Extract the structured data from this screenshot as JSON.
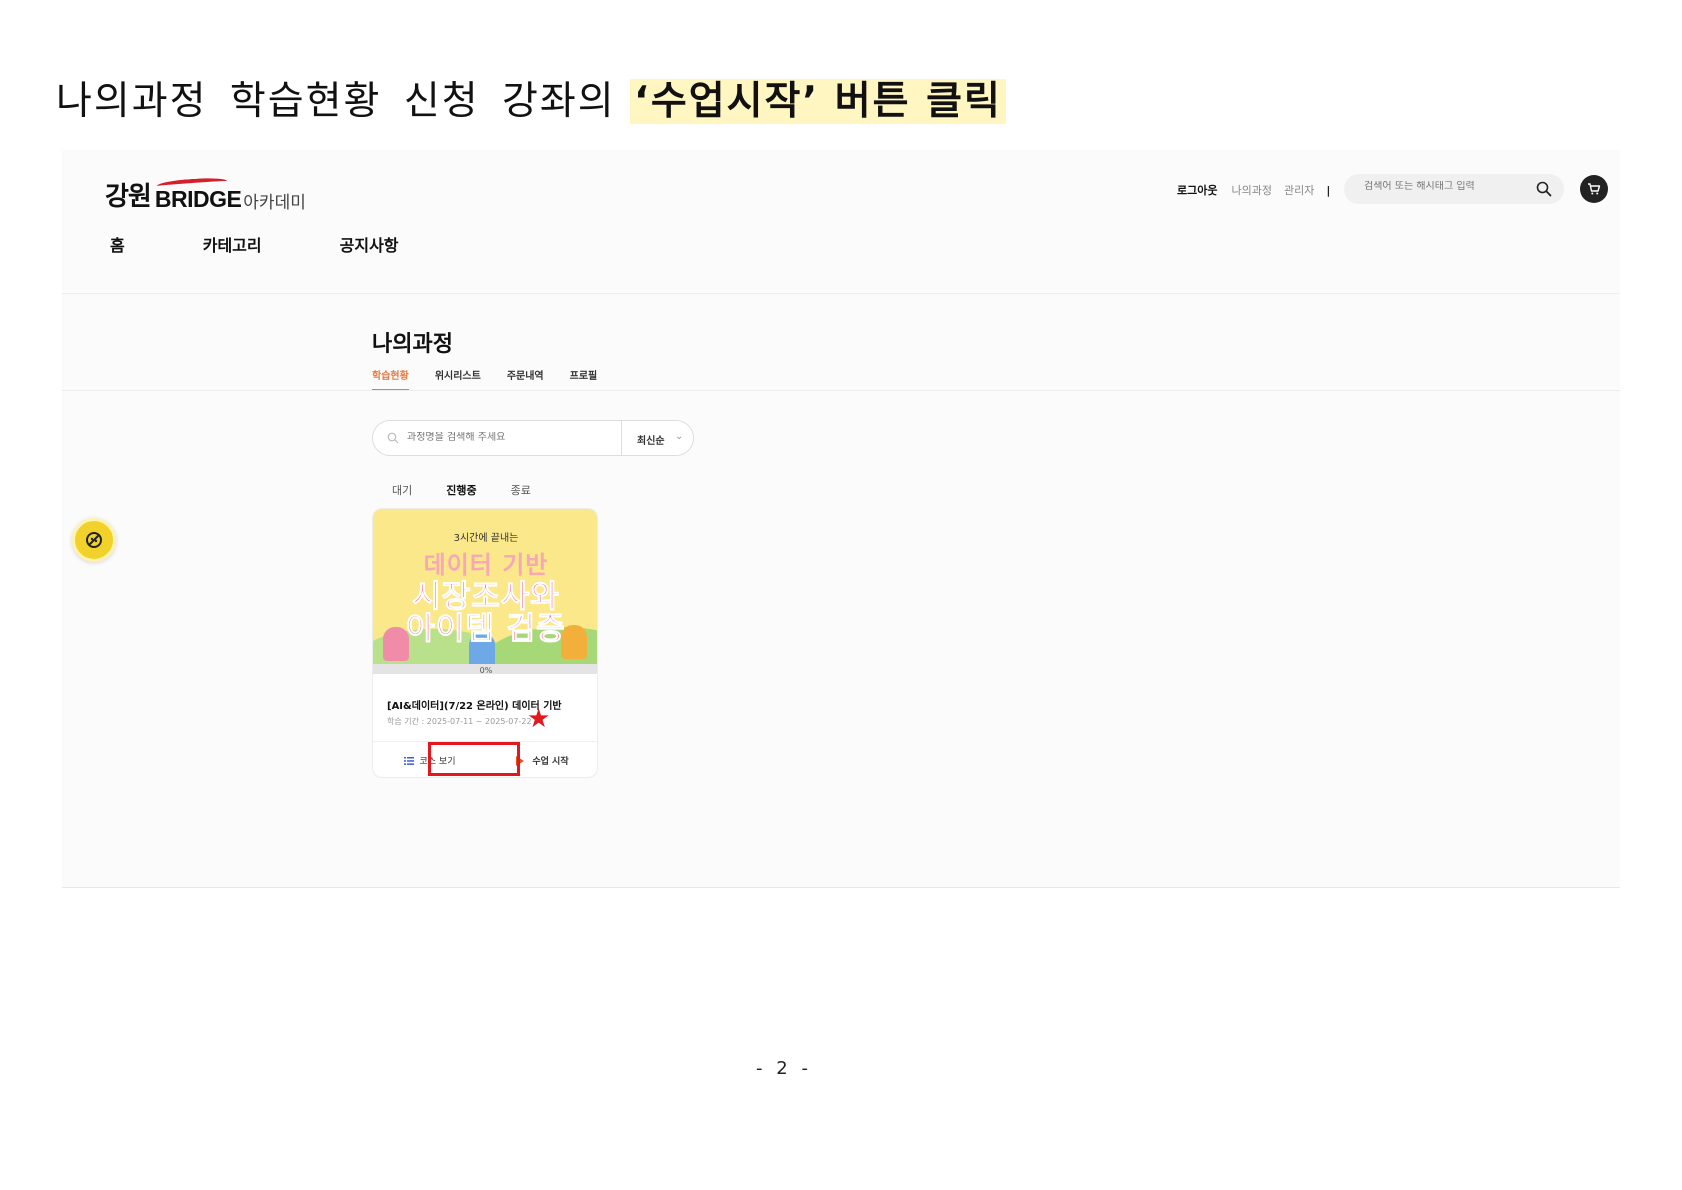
{
  "document": {
    "heading_plain": "나의과정 학습현황 신청 강좌의",
    "heading_highlight": "‘수업시작’ 버튼 클릭",
    "page_number": "- 2 -"
  },
  "site": {
    "logo": {
      "part1": "강원",
      "part2": "BRIDGE",
      "part3": "아카데미"
    },
    "top_links": {
      "logout": "로그아웃",
      "my_course": "나의과정",
      "admin": "관리자",
      "separator": "|"
    },
    "search": {
      "placeholder": "검색어 또는 해시태그 입력"
    },
    "nav": [
      "홈",
      "카테고리",
      "공지사항"
    ]
  },
  "my_course": {
    "title": "나의과정",
    "tabs": [
      "학습현황",
      "위시리스트",
      "주문내역",
      "프로필"
    ],
    "active_tab": "학습현황",
    "filter": {
      "placeholder": "과정명을 검색해 주세요",
      "sort": "최신순"
    },
    "status_tabs": [
      "대기",
      "진행중",
      "종료"
    ],
    "active_status": "진행중"
  },
  "card": {
    "thumb": {
      "small": "3시간에 끝내는",
      "line1": "데이터 기반",
      "line2": "시장조사와",
      "line3": "아이템 검증"
    },
    "progress": 0,
    "progress_label": "0%",
    "title": "[AI&데이터](7/22 온라인) 데이터 기반",
    "period": "학습 기간 : 2025-07-11 ~ 2025-07-22",
    "course_button": "코스 보기",
    "start_button": "수업 시작"
  },
  "colors": {
    "accent": "#e87c44",
    "highlight": "#fff6c2",
    "annotation_red": "#e3171e",
    "fab_yellow": "#f2d22a"
  }
}
